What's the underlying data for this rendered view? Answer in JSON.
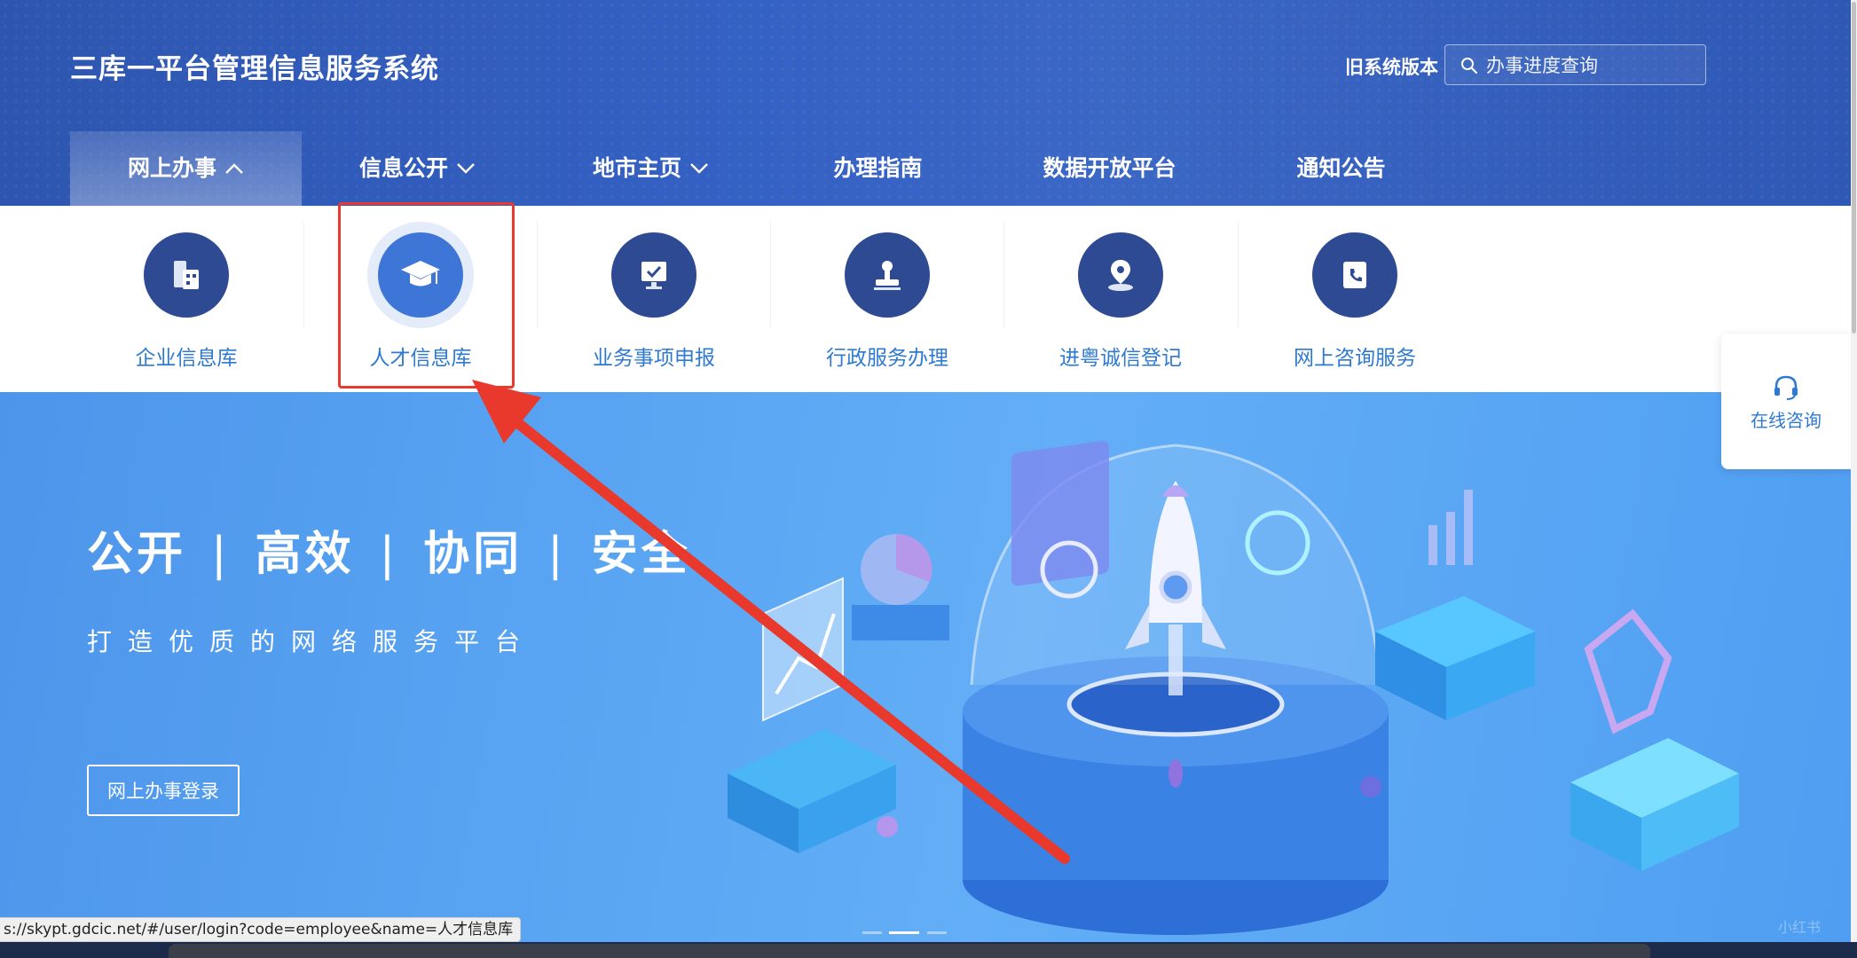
{
  "header": {
    "title": "三库一平台管理信息服务系统",
    "old_version": "旧系统版本",
    "search_placeholder": "办事进度查询"
  },
  "nav": {
    "items": [
      {
        "label": "网上办事",
        "chevron": "up",
        "active": true
      },
      {
        "label": "信息公开",
        "chevron": "down"
      },
      {
        "label": "地市主页",
        "chevron": "down"
      },
      {
        "label": "办理指南"
      },
      {
        "label": "数据开放平台"
      },
      {
        "label": "通知公告"
      }
    ]
  },
  "submenu": {
    "items": [
      {
        "label": "企业信息库",
        "icon": "enterprise-building-icon"
      },
      {
        "label": "人才信息库",
        "icon": "graduation-cap-icon",
        "highlighted": true
      },
      {
        "label": "业务事项申报",
        "icon": "monitor-check-icon"
      },
      {
        "label": "行政服务办理",
        "icon": "stamp-icon"
      },
      {
        "label": "进粤诚信登记",
        "icon": "location-pin-icon"
      },
      {
        "label": "网上咨询服务",
        "icon": "phone-book-icon"
      }
    ]
  },
  "banner": {
    "slogan": [
      "公开",
      "高效",
      "协同",
      "安全"
    ],
    "separator": "|",
    "subtitle": "打造优质的网络服务平台",
    "login_button": "网上办事登录",
    "carousel_active_index": 1
  },
  "consult": {
    "label": "在线咨询",
    "icon": "headset-icon"
  },
  "status_bar": {
    "url": "s://skypt.gdcic.net/#/user/login?code=employee&name=人才信息库"
  },
  "watermark": "小红书",
  "colors": {
    "header": "#3461c4",
    "icon_circle": "#2e4a92",
    "highlight_circle": "#3e76d8",
    "link_blue": "#2f7ad1",
    "annotation_red": "#e9392d"
  }
}
